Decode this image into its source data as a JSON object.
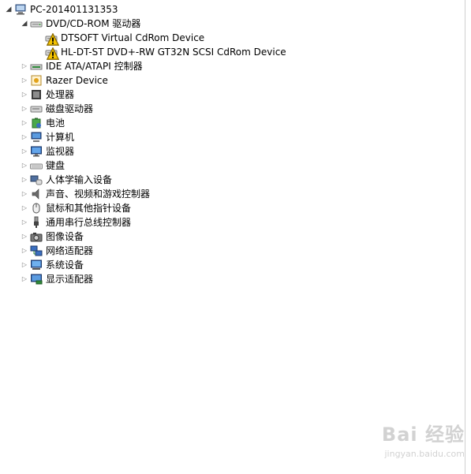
{
  "tree": {
    "root": {
      "label": "PC-201401131353",
      "icon": "computer-icon"
    },
    "dvd": {
      "label": "DVD/CD-ROM 驱动器",
      "icon": "dvd-drive-icon",
      "children": [
        {
          "label": "DTSOFT Virtual CdRom Device",
          "icon": "dvd-drive-warning-icon"
        },
        {
          "label": "HL-DT-ST DVD+-RW GT32N SCSI CdRom Device",
          "icon": "dvd-drive-warning-icon"
        }
      ]
    },
    "categories": [
      {
        "label": "IDE ATA/ATAPI 控制器",
        "icon": "ide-controller-icon"
      },
      {
        "label": "Razer Device",
        "icon": "razer-device-icon"
      },
      {
        "label": "处理器",
        "icon": "processor-icon"
      },
      {
        "label": "磁盘驱动器",
        "icon": "disk-drive-icon"
      },
      {
        "label": "电池",
        "icon": "battery-icon"
      },
      {
        "label": "计算机",
        "icon": "computer-category-icon"
      },
      {
        "label": "监视器",
        "icon": "monitor-icon"
      },
      {
        "label": "键盘",
        "icon": "keyboard-icon"
      },
      {
        "label": "人体学输入设备",
        "icon": "hid-icon"
      },
      {
        "label": "声音、视频和游戏控制器",
        "icon": "sound-icon"
      },
      {
        "label": "鼠标和其他指针设备",
        "icon": "mouse-icon"
      },
      {
        "label": "通用串行总线控制器",
        "icon": "usb-icon"
      },
      {
        "label": "图像设备",
        "icon": "imaging-device-icon"
      },
      {
        "label": "网络适配器",
        "icon": "network-adapter-icon"
      },
      {
        "label": "系统设备",
        "icon": "system-device-icon"
      },
      {
        "label": "显示适配器",
        "icon": "display-adapter-icon"
      }
    ]
  },
  "watermark": {
    "main": "Bai 经验",
    "sub": "jingyan.baidu.com"
  }
}
